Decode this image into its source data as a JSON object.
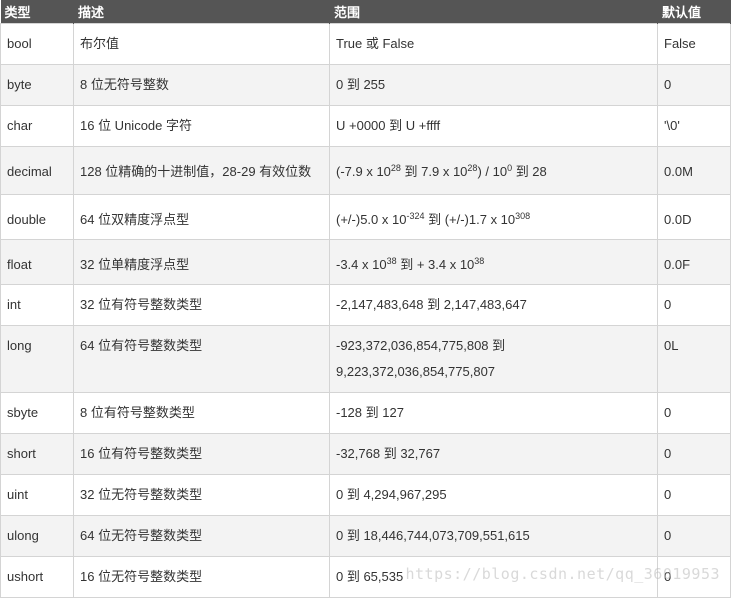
{
  "headers": [
    "类型",
    "描述",
    "范围",
    "默认值"
  ],
  "rows": [
    {
      "type": "bool",
      "desc": "布尔值",
      "range": "True 或 False",
      "default": "False"
    },
    {
      "type": "byte",
      "desc": "8 位无符号整数",
      "range": "0 到 255",
      "default": "0"
    },
    {
      "type": "char",
      "desc": "16 位 Unicode 字符",
      "range": "U +0000 到 U +ffff",
      "default": "'\\0'"
    },
    {
      "type": "decimal",
      "desc": "128 位精确的十进制值，28-29 有效位数",
      "range_parts": [
        "(-7.9 x 10",
        "28",
        " 到 7.9 x 10",
        "28",
        ") / 10",
        "0",
        " 到 28"
      ],
      "default": "0.0M"
    },
    {
      "type": "double",
      "desc": "64 位双精度浮点型",
      "range_parts": [
        "(+/-)5.0 x 10",
        "-324",
        " 到 (+/-)1.7 x 10",
        "308"
      ],
      "default": "0.0D"
    },
    {
      "type": "float",
      "desc": "32 位单精度浮点型",
      "range_parts": [
        "-3.4 x 10",
        "38",
        " 到 + 3.4 x 10",
        "38"
      ],
      "default": "0.0F"
    },
    {
      "type": "int",
      "desc": "32 位有符号整数类型",
      "range": "-2,147,483,648 到 2,147,483,647",
      "default": "0"
    },
    {
      "type": "long",
      "desc": "64 位有符号整数类型",
      "range_lines": [
        "-923,372,036,854,775,808 到",
        "9,223,372,036,854,775,807"
      ],
      "default": "0L"
    },
    {
      "type": "sbyte",
      "desc": "8 位有符号整数类型",
      "range": "-128 到 127",
      "default": "0"
    },
    {
      "type": "short",
      "desc": "16 位有符号整数类型",
      "range": "-32,768 到 32,767",
      "default": "0"
    },
    {
      "type": "uint",
      "desc": "32 位无符号整数类型",
      "range": "0 到 4,294,967,295",
      "default": "0"
    },
    {
      "type": "ulong",
      "desc": "64 位无符号整数类型",
      "range": "0 到 18,446,744,073,709,551,615",
      "default": "0"
    },
    {
      "type": "ushort",
      "desc": "16 位无符号整数类型",
      "range": "0 到 65,535",
      "default": "0"
    }
  ],
  "watermark": "https://blog.csdn.net/qq_36019953"
}
